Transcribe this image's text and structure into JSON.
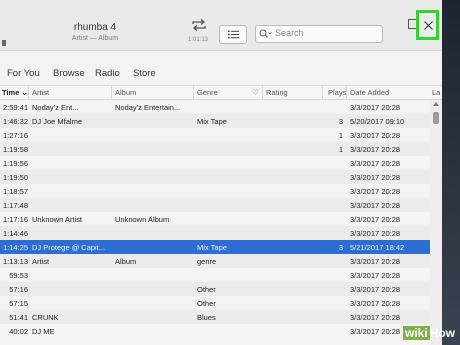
{
  "now_playing": {
    "title": "rhumba 4",
    "subtitle": "Artist — Album",
    "time": "1:01:13"
  },
  "search": {
    "placeholder": "Search"
  },
  "nav": [
    "For You",
    "Browse",
    "Radio",
    "Store"
  ],
  "columns": {
    "time": "Time",
    "artist": "Artist",
    "album": "Album",
    "genre": "Genre",
    "rating": "Rating",
    "plays": "Plays",
    "date_added": "Date Added",
    "last": "La"
  },
  "rows": [
    {
      "time": "2:59:41",
      "artist": "Noday'z  Ent...",
      "album": "Noday'z   Entertain...",
      "genre": "",
      "plays": "",
      "date": "3/3/2017 20:28"
    },
    {
      "time": "1:46:32",
      "artist": "DJ Joe Mfalme",
      "album": "",
      "genre": "Mix Tape",
      "plays": "3",
      "date": "5/20/2017 09:10"
    },
    {
      "time": "1:27:16",
      "artist": "",
      "album": "",
      "genre": "",
      "plays": "1",
      "date": "3/3/2017 20:28"
    },
    {
      "time": "1:19:58",
      "artist": "",
      "album": "",
      "genre": "",
      "plays": "1",
      "date": "3/3/2017 20:28"
    },
    {
      "time": "1:19:56",
      "artist": "",
      "album": "",
      "genre": "",
      "plays": "",
      "date": "3/3/2017 20:28"
    },
    {
      "time": "1:19:50",
      "artist": "",
      "album": "",
      "genre": "",
      "plays": "",
      "date": "3/3/2017 20:28"
    },
    {
      "time": "1:18:57",
      "artist": "",
      "album": "",
      "genre": "",
      "plays": "",
      "date": "3/3/2017 20:28"
    },
    {
      "time": "1:17:48",
      "artist": "",
      "album": "",
      "genre": "",
      "plays": "",
      "date": "3/3/2017 20:28"
    },
    {
      "time": "1:17:16",
      "artist": "Unknown Artist",
      "album": "Unknown Album",
      "genre": "",
      "plays": "",
      "date": "3/3/2017 20:28"
    },
    {
      "time": "1:14:46",
      "artist": "",
      "album": "",
      "genre": "",
      "plays": "",
      "date": "3/3/2017 20:28"
    },
    {
      "time": "1:14:25",
      "artist": "DJ Protege @ Capit...",
      "album": "",
      "genre": "Mix Tape",
      "plays": "3",
      "date": "5/21/2017 18:42"
    },
    {
      "time": "1:13:13",
      "artist": "Artist",
      "album": "Album",
      "genre": "genre",
      "plays": "",
      "date": "3/3/2017 20:28"
    },
    {
      "time": "59:53",
      "artist": "",
      "album": "",
      "genre": "",
      "plays": "",
      "date": "3/3/2017 20:28"
    },
    {
      "time": "57:16",
      "artist": "",
      "album": "",
      "genre": "Other",
      "plays": "",
      "date": "3/3/2017 20:28"
    },
    {
      "time": "57:15",
      "artist": "",
      "album": "",
      "genre": "Other",
      "plays": "",
      "date": "3/3/2017 20:28"
    },
    {
      "time": "51:41",
      "artist": "CRUNK",
      "album": "",
      "genre": "Blues",
      "plays": "",
      "date": "3/3/2017 20:28"
    },
    {
      "time": "40:02",
      "artist": "DJ ME",
      "album": "",
      "genre": "",
      "plays": "",
      "date": "3/3/2017 20:28"
    }
  ],
  "selected_row": 10,
  "watermark": {
    "a": "wiki",
    "b": "How"
  },
  "colors": {
    "selection": "#2c6ed2",
    "close_highlight": "#30d42a"
  }
}
